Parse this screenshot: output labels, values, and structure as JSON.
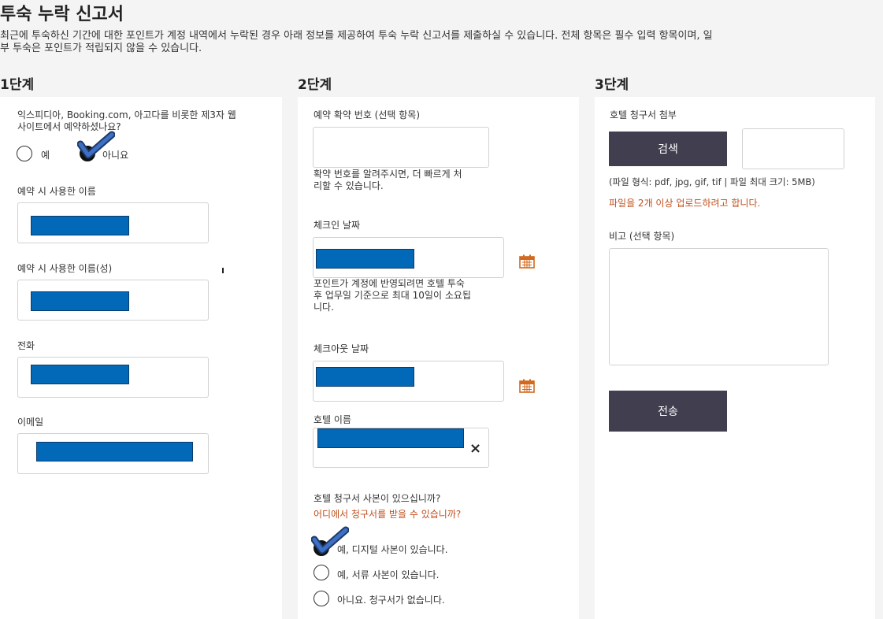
{
  "page": {
    "title": "투숙 누락 신고서",
    "intro_line1": "최근에 투숙하신 기간에 대한 포인트가 계정 내역에서 누락된 경우 아래 정보를 제공하여 투숙 누락 신고서를 제출하실 수 있습니다. 전체 항목은 필수 입력 항목이며, 일",
    "intro_line2": "부 투숙은 포인트가 적립되지 않을 수 있습니다."
  },
  "step1": {
    "heading": "1단계",
    "third_party_question_line1": "익스피디아, Booking.com, 아고다를 비롯한 제3자 웹",
    "third_party_question_line2": "사이트에서 예약하셨나요?",
    "options": [
      {
        "label": "예",
        "selected": false
      },
      {
        "label": "아니요",
        "selected": true
      }
    ],
    "first_name_label": "예약 시 사용한 이름",
    "last_name_label": "예약 시 사용한 이름(성)",
    "phone_label": "전화",
    "email_label": "이메일"
  },
  "step2": {
    "heading": "2단계",
    "confirmation_label": "예약 확약 번호 (선택 항목)",
    "confirmation_hint_line1": "확약 번호를 알려주시면, 더 빠르게 처",
    "confirmation_hint_line2": "리할 수 있습니다.",
    "checkin_label": "체크인 날짜",
    "checkin_hint_line1": "포인트가 계정에 반영되려면 호텔 투숙",
    "checkin_hint_line2": "후 업무일 기준으로 최대 10일이 소요됩",
    "checkin_hint_line3": "니다.",
    "checkout_label": "체크아웃 날짜",
    "hotel_label": "호텔 이름",
    "clear_glyph": "×",
    "invoice_question": "호텔 청구서 사본이 있으십니까?",
    "invoice_link": "어디에서 청구서를 받을 수 있습니까?",
    "invoice_options": [
      {
        "label": "예, 디지털 사본이 있습니다.",
        "selected": true
      },
      {
        "label": "예, 서류 사본이 있습니다.",
        "selected": false
      },
      {
        "label": "아니요. 청구서가 없습니다.",
        "selected": false
      }
    ]
  },
  "step3": {
    "heading": "3단계",
    "attach_label": "호텔 청구서 첨부",
    "browse_button": "검색",
    "file_hint": "(파일 형식: pdf, jpg, gif, tif | 파일 최대 크기: 5MB)",
    "upload_more_link": "파일을 2개 이상 업로드하려고 합니다.",
    "notes_label": "비고 (선택 항목)",
    "submit_button": "전송"
  },
  "icons": {
    "calendar": "calendar-icon",
    "checkmark": "checkmark-icon"
  },
  "colors": {
    "accent_button": "#403e4f",
    "link": "#c0501e",
    "redaction": "#0268b8",
    "calendar": "#d2691e"
  }
}
